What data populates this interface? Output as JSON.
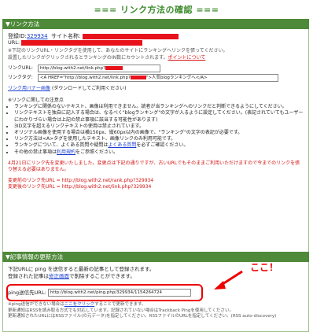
{
  "page_title": "=== リンク方法の確認 ===",
  "link_section": {
    "header": "▼リンク方法",
    "reg_label": "登録ID:",
    "reg_id": "329934",
    "site_label": "サイト名称:",
    "url_label": "URL:",
    "note1": "※下記のリンクURL・リンクタグを使用して、あなたのサイトにランキングへリンクを張ってください。",
    "note2": "設置したリンクがクリックされるとランキングのIN数にカウントされます。",
    "point_link": "ポイントについて",
    "link_url_label": "リンクURL:",
    "link_url_value": "http://blog.with2.net/link.php?",
    "link_tag_label": "リンクタグ:",
    "link_tag_value_a": "<A HREF=\"http://blog.with2.net/link.php?",
    "link_tag_value_b": "\">人気blogランキングへ</A>",
    "banner_link": "リンク用バナー画像",
    "banner_note": "(ダウンロードしてご利用ください)",
    "caution_head": "※リンクに関しての注意点",
    "cautions": [
      "ランキングに関係のないテキスト、画像は利用できません。読者が当ランキングへのリンクだと判断できるようにしてください。",
      "リンクテキストを独自に記入する場合は、なるべく\"blogランキング\"の文字が入るように設定してください。(表記されていてもユーザーにわかりづらい場合は上記の禁止事項に該当する可能性があります)",
      "3ID文字を超えるリンクテキストの使用は禁止されています。",
      "オリジナル画像を使用する場合は横150px、縦60px以内の画像で、\"ランキング\"の文字の表記が必要です。",
      "リンク方法は<A>タグを使用したテキスト、画像リンクのみ利用可能です。",
      "ランキングについて、よくある質問や疑問は",
      "その他の禁止事項は"
    ],
    "faq_link": "よくある質問",
    "faq_suffix": "を必ずご確認ください。",
    "rules_link": "利用規約",
    "rules_suffix": "をご参照ください。",
    "red_notice": "4月21日にリンク先を変更いたしました。変更点は下記の通りですが、古いURLでもそのままご利用いただけますので今までのリンクを張り替える必要はありません。",
    "old_url_label": "変更前のリンク先URL = ",
    "old_url": "http://blog.with2.net/rank.php?329934",
    "new_url_label": "変更後のリンク先URL = ",
    "new_url": "http://blog.with2.net/link.php?329934"
  },
  "update_section": {
    "header": "▼記事情報の更新方法",
    "line1": "下記URLに ping を送信すると最新の記事として登録されます。",
    "line2a": "登録された記事は",
    "edit_link": "修正画面",
    "line2b": "で削除することができます。",
    "ping_label": "ping送信先URL:",
    "ping_value": "http://blog.with2.net/ping.php/329934/1154264724",
    "annotation": "ここ！",
    "foot1a": "※ping送信ができない場合は",
    "foot1_link": "ここをクリック",
    "foot1b": "することで更新できます。",
    "foot2": "更新通知はRSSを読み取る方式でも対応しています。記録されていない場合はTrackback Pingを使用してください。",
    "foot3": "更新通知されたURLにはRSSファイル(の元データ)を指定してください。RSSファイルのURLを指定してください。(RSS auto-discovery)"
  },
  "colors": {
    "header_bg": "#4f8a3a",
    "title": "#3a8a2a",
    "alert": "#e8121b",
    "link": "#1a3fd0"
  }
}
